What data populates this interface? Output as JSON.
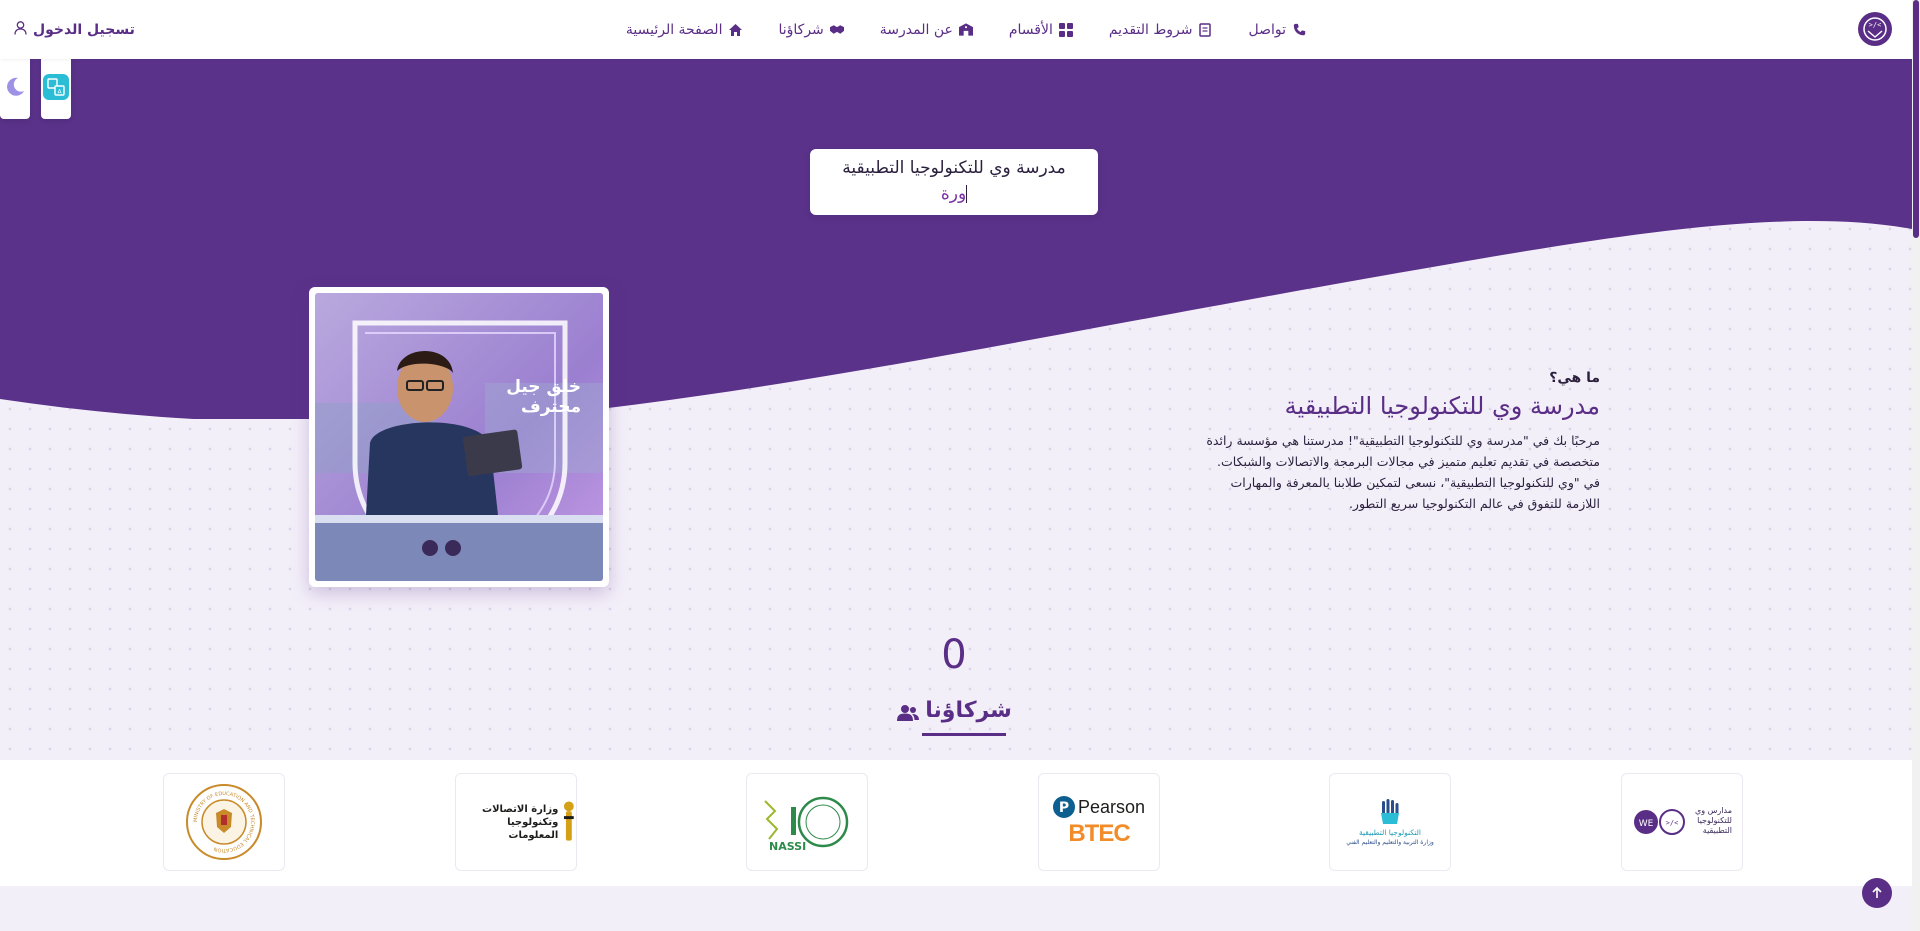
{
  "nav": {
    "items": [
      {
        "label": "تواصل",
        "icon": "phone-icon"
      },
      {
        "label": "شروط التقديم",
        "icon": "document-icon"
      },
      {
        "label": "الأقسام",
        "icon": "grid-icon"
      },
      {
        "label": "عن المدرسة",
        "icon": "school-icon"
      },
      {
        "label": "شركاؤنا",
        "icon": "handshake-icon"
      },
      {
        "label": "الصفحة الرئيسية",
        "icon": "home-icon"
      }
    ],
    "login_label": "تسجيل الدخول"
  },
  "hero": {
    "typing_line1": "مدرسة وي للتكنولوجيا التطبيقية",
    "typing_line2": "ورة"
  },
  "photo": {
    "overlay_line1": "خلق جيل",
    "overlay_line2": "محترف"
  },
  "about": {
    "kicker": "ما هي؟",
    "title": "مدرسة وي للتكنولوجيا التطبيقية",
    "text": "مرحبًا بك في \"مدرسة وي للتكنولوجيا التطبيقية\"! مدرستنا هي مؤسسة رائدة متخصصة في تقديم تعليم متميز في مجالات البرمجة والاتصالات والشبكات. في \"وي للتكنولوجيا التطبيقية\"، نسعى لتمكين طلابنا بالمعرفة والمهارات اللازمة للتفوق في عالم التكنولوجيا سريع التطور."
  },
  "partners": {
    "counter": "0",
    "heading": "شركاؤنا",
    "logos": [
      {
        "name": "we-schools",
        "text1": "مدارس وي",
        "text2": "للتكنولوجيا التطبيقية"
      },
      {
        "name": "applied-technology",
        "text1": "التكنولوجيا التطبيقية",
        "text2": "وزارة التربية والتعليم والتعليم الفني"
      },
      {
        "name": "pearson-btec",
        "text1": "Pearson",
        "text2": "BTEC"
      },
      {
        "name": "nassi",
        "text1": "NASSI"
      },
      {
        "name": "mcit",
        "text1": "وزارة الاتصالات",
        "text2": "وتكنولوجيا المعلومات"
      },
      {
        "name": "ministry-of-education",
        "text1": "MINISTRY OF EDUCATION AND TECHNICAL EDUCATION"
      }
    ]
  },
  "colors": {
    "brand_purple": "#5a2e86",
    "background": "#f3eff9",
    "accent_teal": "#2bbcd6"
  }
}
